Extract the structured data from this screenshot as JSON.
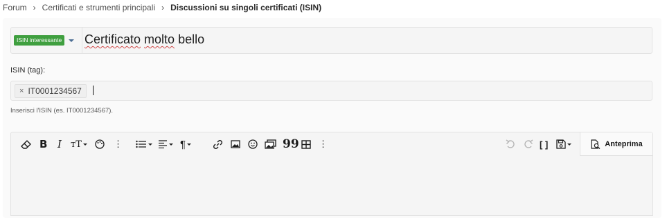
{
  "breadcrumb": {
    "items": [
      "Forum",
      "Certificati e strumenti principali"
    ],
    "current": "Discussioni su singoli certificati (ISIN)"
  },
  "title_row": {
    "prefix_label": "ISIN interessante",
    "title_word1": "Certificato",
    "title_word2": "molto",
    "title_word3": "bello"
  },
  "tags": {
    "label": "ISIN (tag):",
    "chip_remove": "×",
    "chips": [
      "IT0001234567"
    ],
    "hint": "Inserisci l'ISIN (es. IT0001234567)."
  },
  "editor": {
    "preview_label": "Anteprima",
    "tools": [
      "eraser-icon",
      "bold-icon",
      "italic-icon",
      "text-size-icon",
      "palette-icon",
      "more-icon",
      "list-icon",
      "align-icon",
      "paragraph-icon",
      "link-icon",
      "image-icon",
      "smiley-icon",
      "media-icon",
      "quote-icon",
      "table-icon",
      "more-icon",
      "undo-icon",
      "redo-icon",
      "bbcode-icon",
      "drafts-icon",
      "preview-icon"
    ],
    "colors": {
      "prefix_bg": "#3f9f3f",
      "accent": "#4a6d93"
    }
  }
}
